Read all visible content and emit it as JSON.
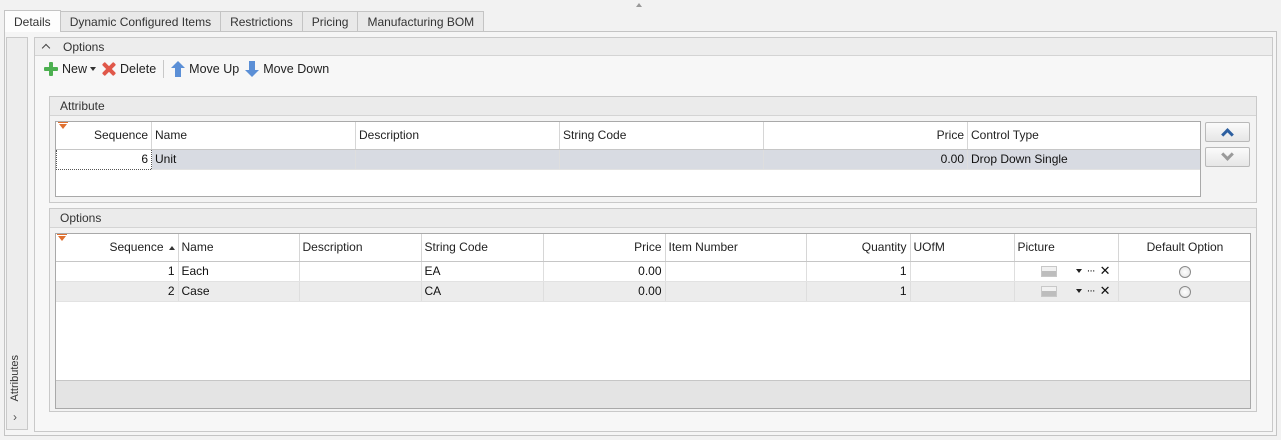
{
  "tabs": [
    {
      "label": "Details",
      "active": true
    },
    {
      "label": "Dynamic Configured Items"
    },
    {
      "label": "Restrictions"
    },
    {
      "label": "Pricing"
    },
    {
      "label": "Manufacturing BOM"
    }
  ],
  "side_panel": {
    "label": "Attributes",
    "chevron": "›"
  },
  "options_panel": {
    "title": "Options"
  },
  "toolbar": {
    "new_label": "New",
    "delete_label": "Delete",
    "move_up_label": "Move Up",
    "move_down_label": "Move Down",
    "icons": {
      "new": "green-plus-icon",
      "delete": "red-x-icon",
      "move_up": "blue-up-arrow-icon",
      "move_down": "blue-down-arrow-icon"
    }
  },
  "attribute_group": {
    "title": "Attribute",
    "columns": [
      "Sequence",
      "Name",
      "Description",
      "String Code",
      "Price",
      "Control Type"
    ],
    "rows": [
      {
        "sequence": "6",
        "name": "Unit",
        "description": "",
        "string_code": "",
        "price": "0.00",
        "control_type": "Drop Down Single"
      }
    ]
  },
  "options_group": {
    "title": "Options",
    "columns": [
      "Sequence",
      "Name",
      "Description",
      "String Code",
      "Price",
      "Item Number",
      "Quantity",
      "UOfM",
      "Picture",
      "Default Option"
    ],
    "rows": [
      {
        "sequence": "1",
        "name": "Each",
        "description": "",
        "string_code": "EA",
        "price": "0.00",
        "item_number": "",
        "quantity": "1",
        "uofm": "",
        "picture_actions": "···",
        "picture_clear": "✕"
      },
      {
        "sequence": "2",
        "name": "Case",
        "description": "",
        "string_code": "CA",
        "price": "0.00",
        "item_number": "",
        "quantity": "1",
        "uofm": "",
        "picture_actions": "···",
        "picture_clear": "✕"
      }
    ]
  },
  "colors": {
    "selected_row": "#d8dbe2",
    "filter_marker": "#e07030",
    "nav_arrow": "#2d5fa0"
  }
}
